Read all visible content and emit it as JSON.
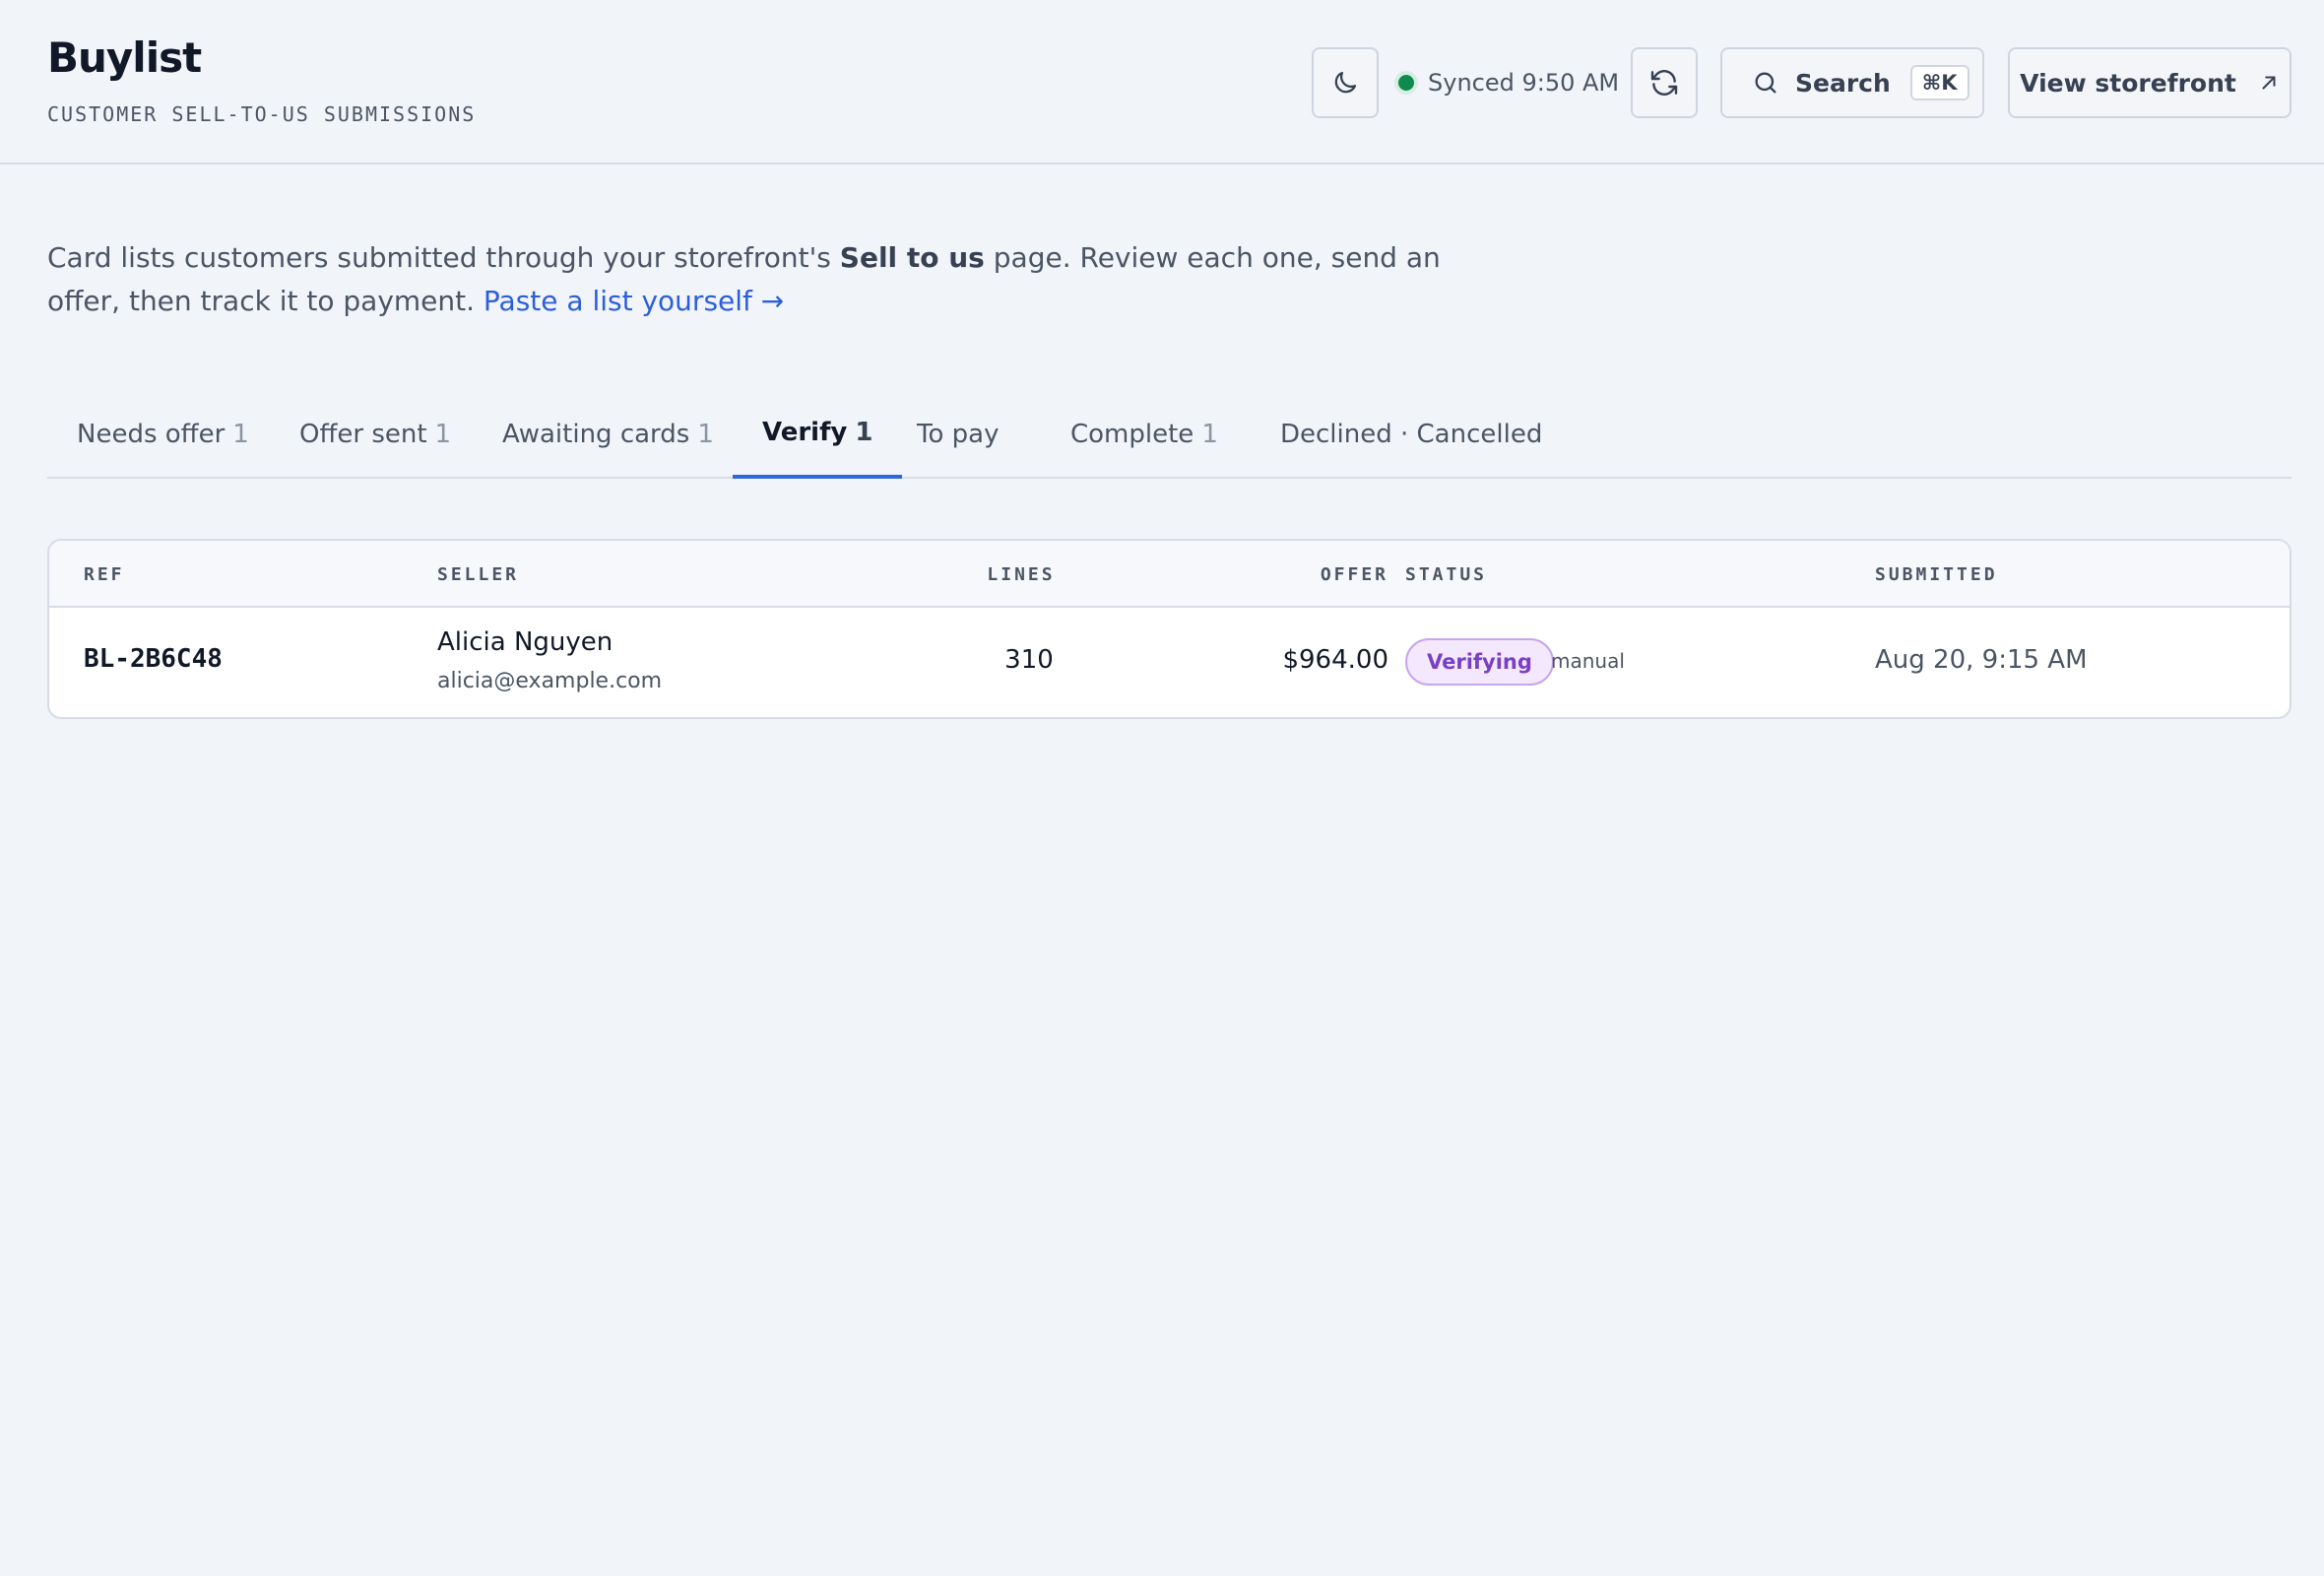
{
  "header": {
    "title": "Buylist",
    "subtitle": "CUSTOMER SELL-TO-US SUBMISSIONS",
    "sync_status": "Synced 9:50 AM",
    "search_label": "Search",
    "search_shortcut": "⌘K",
    "storefront_label": "View storefront"
  },
  "intro": {
    "text_before": "Card lists customers submitted through your storefront's ",
    "bold": "Sell to us",
    "text_after": " page. Review each one, send an offer, then track it to payment. ",
    "link": "Paste a list yourself →"
  },
  "tabs": [
    {
      "label": "Needs offer",
      "count": "1"
    },
    {
      "label": "Offer sent",
      "count": "1"
    },
    {
      "label": "Awaiting cards",
      "count": "1"
    },
    {
      "label": "Verify",
      "count": "1",
      "active": true
    },
    {
      "label": "To pay",
      "count": ""
    },
    {
      "label": "Complete",
      "count": "1"
    },
    {
      "label": "Declined · Cancelled",
      "count": ""
    }
  ],
  "table": {
    "columns": {
      "ref": "REF",
      "seller": "SELLER",
      "lines": "LINES",
      "offer": "OFFER",
      "status": "STATUS",
      "submitted": "SUBMITTED"
    },
    "rows": [
      {
        "ref": "BL-2B6C48",
        "seller_name": "Alicia Nguyen",
        "seller_email": "alicia@example.com",
        "lines": "310",
        "offer": "$964.00",
        "status": "Verifying",
        "status_note": "manual",
        "submitted": "Aug 20, 9:15 AM"
      }
    ]
  },
  "colors": {
    "accent": "#2f66e0",
    "sync": "#0e8a4f",
    "status": "#7a3fc4"
  },
  "icons": [
    "moon-icon",
    "refresh-icon",
    "search-icon",
    "external-link-icon"
  ]
}
